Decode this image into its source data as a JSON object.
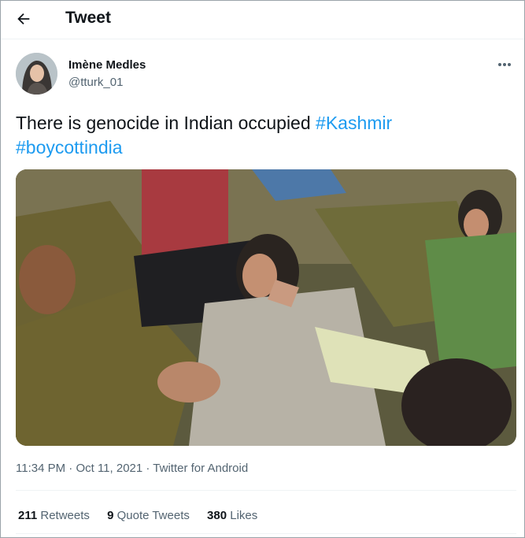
{
  "header": {
    "title": "Tweet",
    "back_icon": "arrow-left-icon"
  },
  "author": {
    "name": "Imène Medles",
    "handle": "@tturk_01",
    "more_icon": "ellipsis-icon"
  },
  "tweet": {
    "text_plain": "There is genocide in Indian occupied ",
    "hashtags": [
      "#Kashmir",
      "#boycottindia"
    ]
  },
  "meta": {
    "time": "11:34 PM",
    "sep1": " · ",
    "date": "Oct 11, 2021",
    "sep2": " · ",
    "source": "Twitter for Android"
  },
  "stats": {
    "retweets_count": "211",
    "retweets_label": "Retweets",
    "quotes_count": "9",
    "quotes_label": "Quote Tweets",
    "likes_count": "380",
    "likes_label": "Likes"
  },
  "colors": {
    "accent": "#1d9bf0",
    "text": "#0f1419",
    "secondary": "#536471"
  }
}
